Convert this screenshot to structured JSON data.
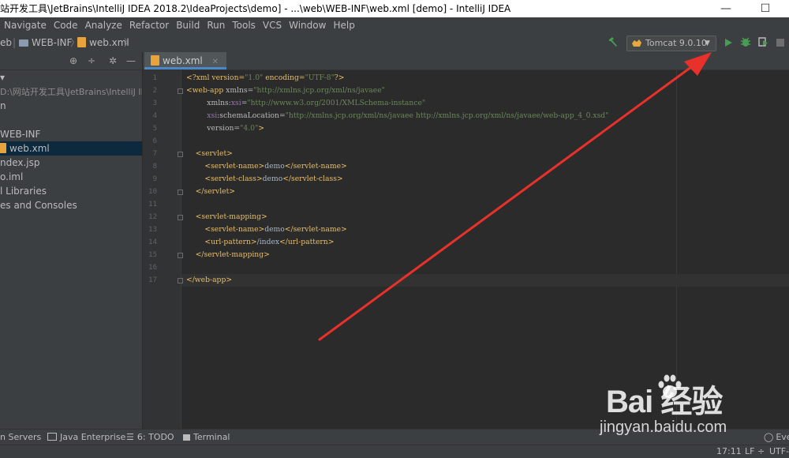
{
  "window": {
    "title": "站开发工具\\JetBrains\\IntelliJ IDEA 2018.2\\IdeaProjects\\demo] - ...\\web\\WEB-INF\\web.xml [demo] - IntelliJ IDEA",
    "minimize": "—",
    "maximize": "☐"
  },
  "menu": [
    "Navigate",
    "Code",
    "Analyze",
    "Refactor",
    "Build",
    "Run",
    "Tools",
    "VCS",
    "Window",
    "Help"
  ],
  "breadcrumb": {
    "items": [
      "eb",
      "WEB-INF",
      "web.xml"
    ]
  },
  "toolbar": {
    "run_config": "Tomcat 9.0.10",
    "icons": [
      "hammer-icon",
      "run-icon",
      "debug-icon",
      "coverage-icon",
      "stop-icon"
    ],
    "accent_green": "#499c54"
  },
  "project": {
    "tree": [
      {
        "label": "▾",
        "indent": 0,
        "selected": false
      },
      {
        "label": "D:\\网站开发工具\\JetBrains\\IntelliJ IDEA",
        "indent": 1,
        "selected": false
      },
      {
        "label": "n",
        "indent": 0,
        "selected": false
      },
      {
        "label": "",
        "indent": 0,
        "selected": false
      },
      {
        "label": "WEB-INF",
        "indent": 0,
        "selected": false
      },
      {
        "label": "web.xml",
        "indent": 0,
        "selected": true
      },
      {
        "label": "ndex.jsp",
        "indent": 0,
        "selected": false
      },
      {
        "label": "o.iml",
        "indent": 0,
        "selected": false
      },
      {
        "label": "l Libraries",
        "indent": 0,
        "selected": false
      },
      {
        "label": "es and Consoles",
        "indent": 0,
        "selected": false
      }
    ]
  },
  "editor": {
    "tab": "web.xml",
    "lines": [
      {
        "n": "1",
        "html": "<span class=\"pi\">&lt;?xml version=</span><span class=\"v\">\"1.0\"</span><span class=\"pi\"> encoding=</span><span class=\"v\">\"UTF-8\"</span><span class=\"pi\">?&gt;</span>"
      },
      {
        "n": "2",
        "html": "<span class=\"t\">&lt;web-app</span> <span class=\"a\">xmlns=</span><span class=\"v\">\"http://xmlns.jcp.org/xml/ns/javaee\"</span>"
      },
      {
        "n": "3",
        "html": "         <span class=\"a\">xmlns:</span><span class=\"n\">xsi</span><span class=\"a\">=</span><span class=\"v\">\"http://www.w3.org/2001/XMLSchema-instance\"</span>"
      },
      {
        "n": "4",
        "html": "         <span class=\"n\">xsi</span><span class=\"a\">:schemaLocation=</span><span class=\"v\">\"http://xmlns.jcp.org/xml/ns/javaee http://xmlns.jcp.org/xml/ns/javaee/web-app_4_0.xsd\"</span>"
      },
      {
        "n": "5",
        "html": "         <span class=\"a\">version=</span><span class=\"v\">\"4.0\"</span><span class=\"t\">&gt;</span>"
      },
      {
        "n": "6",
        "html": ""
      },
      {
        "n": "7",
        "html": "    <span class=\"t\">&lt;servlet&gt;</span>"
      },
      {
        "n": "8",
        "html": "        <span class=\"t\">&lt;servlet-name&gt;</span><span class=\"tx\">demo</span><span class=\"t\">&lt;/servlet-name&gt;</span>"
      },
      {
        "n": "9",
        "html": "        <span class=\"t\">&lt;servlet-class&gt;</span><span class=\"tx\">demo</span><span class=\"t\">&lt;/servlet-class&gt;</span>"
      },
      {
        "n": "10",
        "html": "    <span class=\"t\">&lt;/servlet&gt;</span>"
      },
      {
        "n": "11",
        "html": ""
      },
      {
        "n": "12",
        "html": "    <span class=\"t\">&lt;servlet-mapping&gt;</span>"
      },
      {
        "n": "13",
        "html": "        <span class=\"t\">&lt;servlet-name&gt;</span><span class=\"tx\">demo</span><span class=\"t\">&lt;/servlet-name&gt;</span>"
      },
      {
        "n": "14",
        "html": "        <span class=\"t\">&lt;url-pattern&gt;</span><span class=\"tx\">/index</span><span class=\"t\">&lt;/url-pattern&gt;</span>"
      },
      {
        "n": "15",
        "html": "    <span class=\"t\">&lt;/servlet-mapping&gt;</span>"
      },
      {
        "n": "16",
        "html": ""
      },
      {
        "n": "17",
        "html": "<span class=\"t\">&lt;/web-app&gt;</span>"
      }
    ]
  },
  "bottom_tools": [
    {
      "label": "n Servers"
    },
    {
      "label": "Java Enterprise"
    },
    {
      "label": "6: TODO"
    },
    {
      "label": "Terminal"
    },
    {
      "label": "Eve"
    }
  ],
  "status": {
    "position": "17:11",
    "line_sep": "LF ÷",
    "encoding": "UTF-"
  },
  "watermark": {
    "brand": "Bai 经验",
    "url": "jingyan.baidu.com"
  },
  "annotation_color": "#e8312a"
}
